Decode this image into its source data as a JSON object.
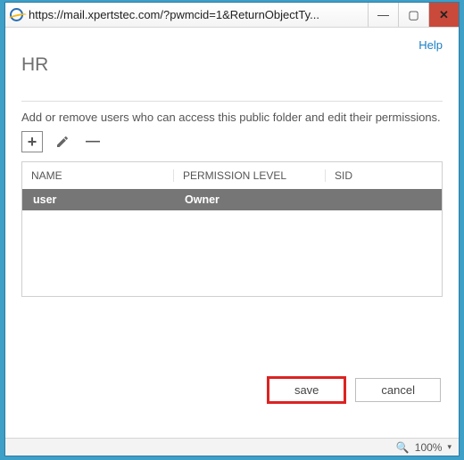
{
  "titlebar": {
    "url": "https://mail.xpertstec.com/?pwmcid=1&ReturnObjectTy..."
  },
  "help_label": "Help",
  "page_title": "HR",
  "description": "Add or remove users who can access this public folder and edit their permissions.",
  "toolbar": {
    "add_glyph": "+",
    "remove_glyph": "—"
  },
  "table": {
    "headers": {
      "name": "NAME",
      "permission": "PERMISSION LEVEL",
      "sid": "SID"
    },
    "rows": [
      {
        "name": "user",
        "permission": "Owner",
        "sid": ""
      }
    ]
  },
  "buttons": {
    "save": "save",
    "cancel": "cancel"
  },
  "status": {
    "zoom": "100%"
  }
}
